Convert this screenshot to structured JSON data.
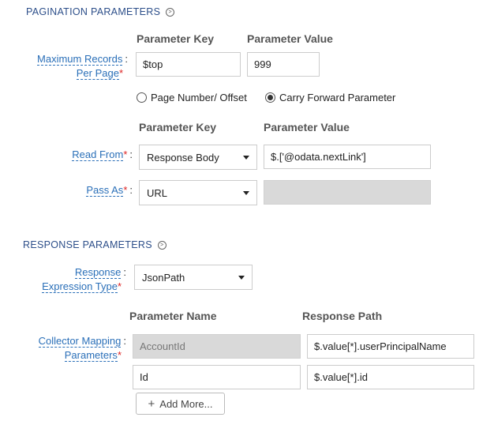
{
  "pagination": {
    "title": "PAGINATION PARAMETERS",
    "col_key": "Parameter Key",
    "col_value": "Parameter Value",
    "max_records_label_1": "Maximum Records",
    "max_records_label_2": "Per Page",
    "max_key": "$top",
    "max_value": "999",
    "radio_page_number": "Page Number/ Offset",
    "radio_carry_forward": "Carry Forward Parameter",
    "selected_radio": "carry_forward",
    "col_key_2": "Parameter Key",
    "col_value_2": "Parameter Value",
    "read_from_label": "Read From",
    "read_from_select": "Response Body",
    "read_from_value": "$.['@odata.nextLink']",
    "pass_as_label": "Pass As",
    "pass_as_select": "URL",
    "pass_as_value": ""
  },
  "response": {
    "title": "RESPONSE PARAMETERS",
    "expr_label_1": "Response",
    "expr_label_2": "Expression Type",
    "expr_select": "JsonPath",
    "col_name": "Parameter Name",
    "col_path": "Response Path",
    "collector_label_1": "Collector Mapping",
    "collector_label_2": "Parameters",
    "rows": [
      {
        "name": "AccountId",
        "path": "$.value[*].userPrincipalName"
      },
      {
        "name": "Id",
        "path": "$.value[*].id"
      }
    ],
    "add_more": "Add More..."
  },
  "colors": {
    "label_blue": "#2a6fb8",
    "section_title": "#2d4f8a",
    "required_red": "#dd2222",
    "disabled_bg": "#d9d9d9"
  }
}
